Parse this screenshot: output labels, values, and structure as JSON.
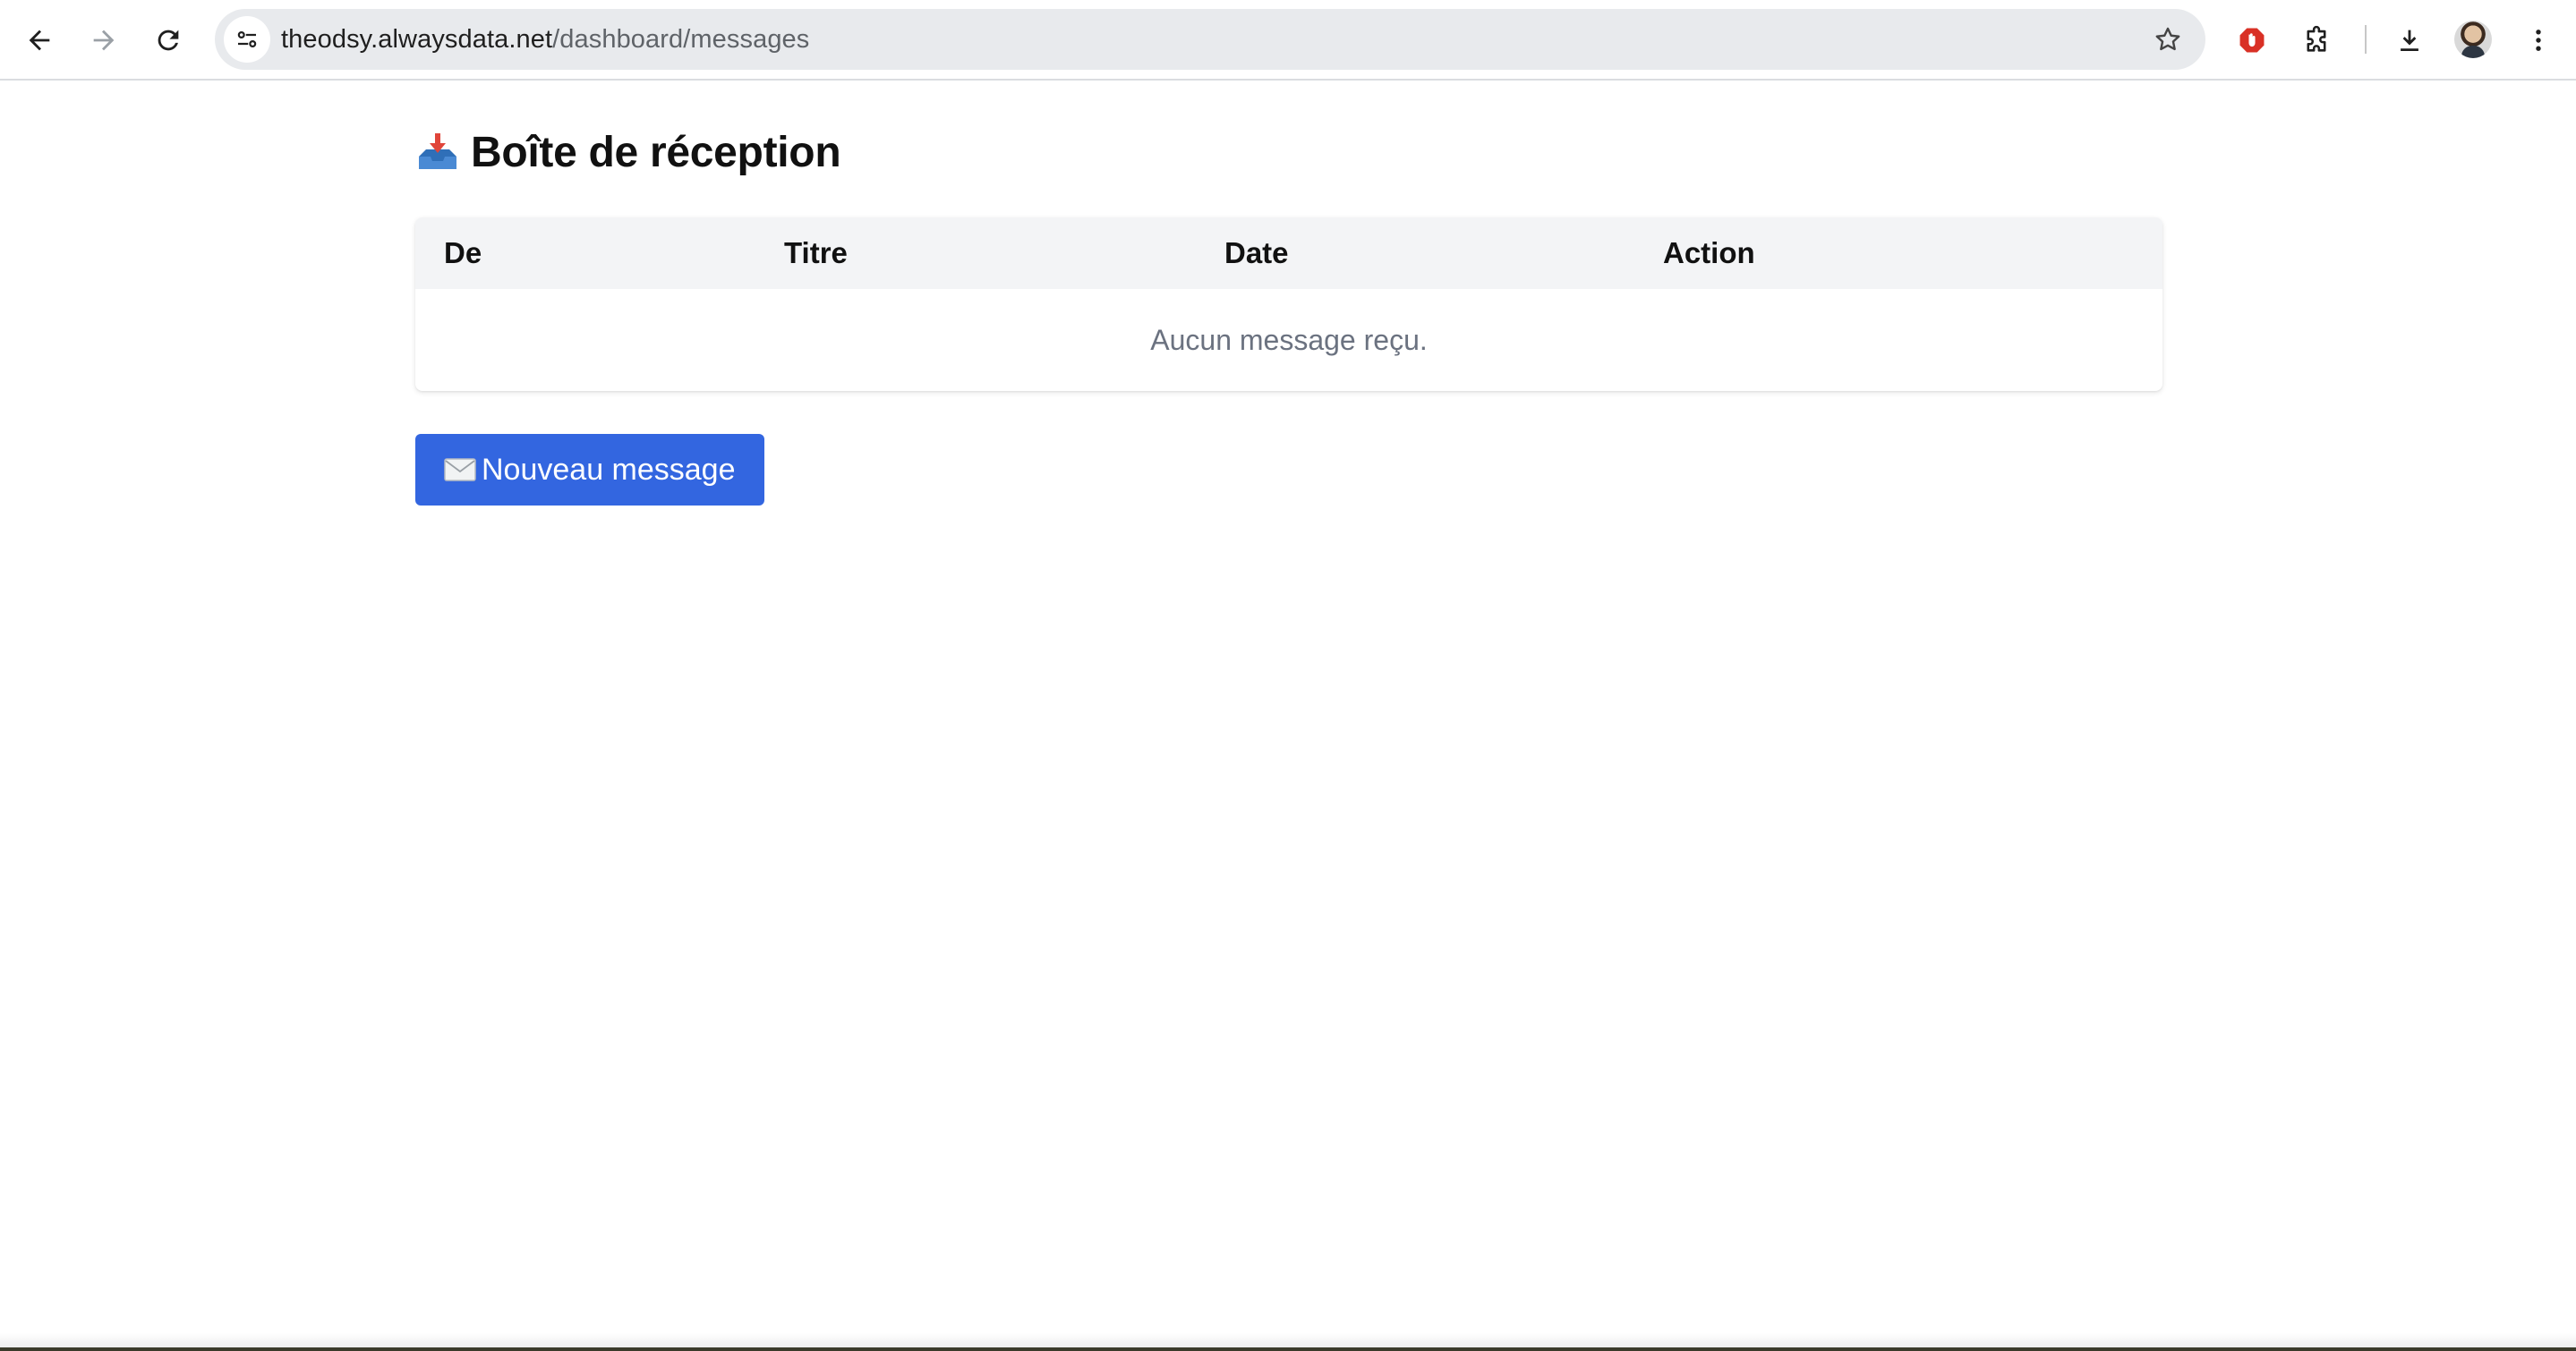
{
  "browser": {
    "url_host": "theodsy.alwaysdata.net",
    "url_path": "/dashboard/messages",
    "icons": [
      "back-arrow-icon",
      "forward-arrow-icon",
      "reload-icon",
      "site-info-icon",
      "bookmark-star-icon",
      "adblock-extension-icon",
      "extensions-puzzle-icon",
      "download-icon",
      "profile-avatar",
      "more-vert-icon"
    ]
  },
  "page": {
    "title": "Boîte de réception",
    "title_icon": "inbox-tray-icon"
  },
  "inbox_table": {
    "columns": [
      "De",
      "Titre",
      "Date",
      "Action"
    ],
    "empty_message": "Aucun message reçu."
  },
  "new_message_button": {
    "label": "Nouveau message",
    "icon": "envelope-icon"
  },
  "colors": {
    "primary_button": "#3366e0",
    "table_header_bg": "#f3f4f6",
    "muted_text": "#6b7280"
  }
}
